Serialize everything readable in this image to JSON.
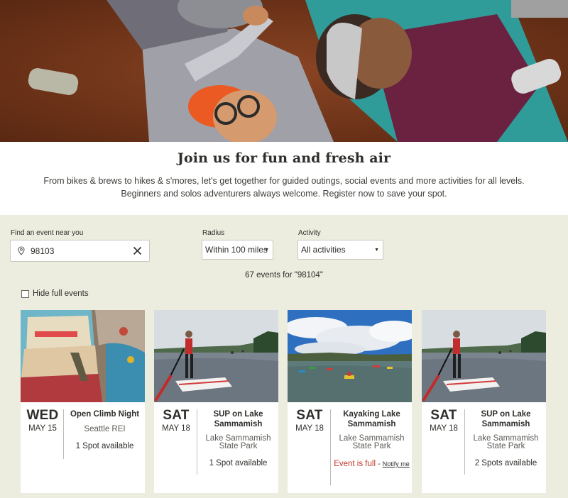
{
  "intro": {
    "title": "Join us for fun and fresh air",
    "line1": "From bikes & brews to hikes & s'mores, let's get together for guided outings, social events and more activities for all levels.",
    "line2": "Beginners and solos adventurers always welcome. Register now to save your spot."
  },
  "search": {
    "location_label": "Find an event near you",
    "location_value": "98103",
    "radius_label": "Radius",
    "radius_value": "Within 100 miles",
    "activity_label": "Activity",
    "activity_value": "All activities",
    "results_count": "67 events for \"98104\"",
    "hide_full_label": "Hide full events"
  },
  "icons": {
    "location": "map-pin-icon",
    "clear": "close-icon",
    "caret": "caret-down-icon"
  },
  "colors": {
    "finder_bg": "#ececdf",
    "full_text": "#c0392b"
  },
  "events": [
    {
      "dow": "WED",
      "date": "MAY 15",
      "title": "Open Climb Night",
      "location": "Seattle REI",
      "status": "1 Spot available"
    },
    {
      "dow": "SAT",
      "date": "MAY 18",
      "title": "SUP on Lake Sammamish",
      "location": "Lake Sammamish State Park",
      "status": "1 Spot available"
    },
    {
      "dow": "SAT",
      "date": "MAY 18",
      "title": "Kayaking Lake Sammamish",
      "location": "Lake Sammamish State Park",
      "status": "Event is full",
      "status_sep": "-",
      "notify": "Notify me"
    },
    {
      "dow": "SAT",
      "date": "MAY 18",
      "title": "SUP on Lake Sammamish",
      "location": "Lake Sammamish State Park",
      "status": "2 Spots available"
    }
  ]
}
